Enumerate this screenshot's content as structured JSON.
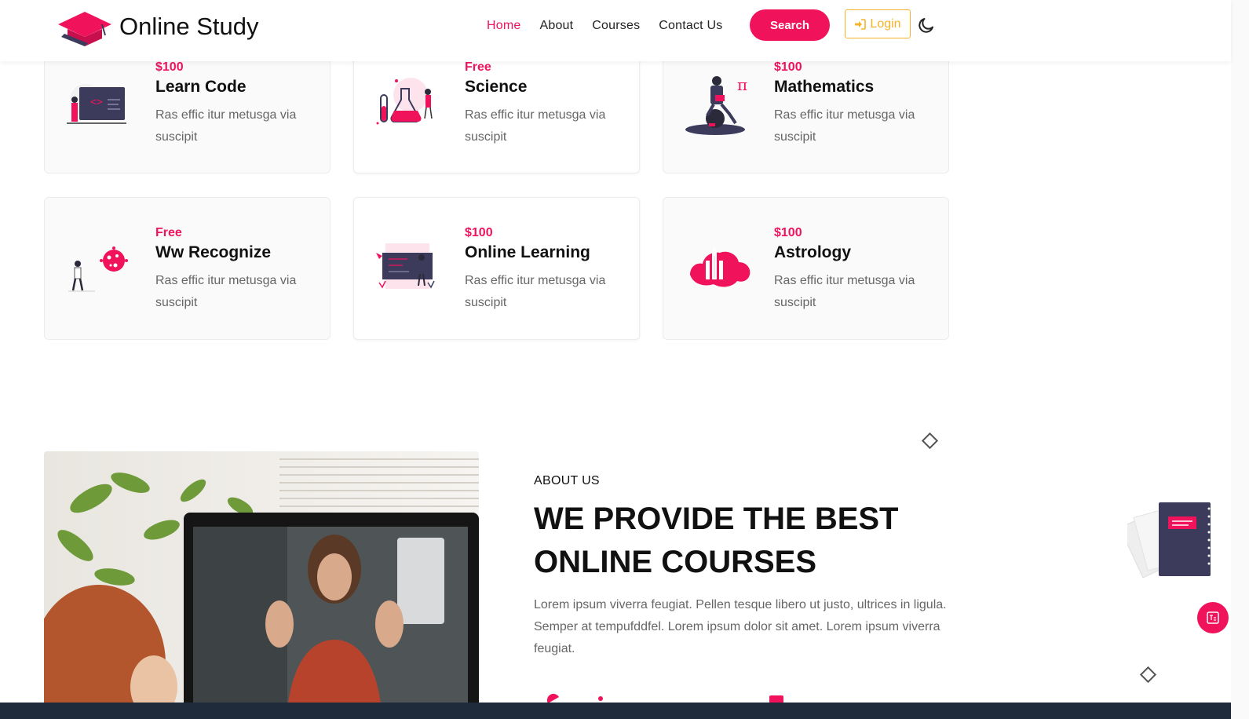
{
  "brand": {
    "name": "Online Study"
  },
  "nav": {
    "items": [
      {
        "label": "Home",
        "active": true
      },
      {
        "label": "About",
        "active": false
      },
      {
        "label": "Courses",
        "active": false
      },
      {
        "label": "Contact Us",
        "active": false
      }
    ],
    "search_label": "Search",
    "login_label": "Login"
  },
  "courses": [
    {
      "price": "$100",
      "title": "Learn Code",
      "desc": "Ras effic itur metusga via suscipit",
      "icon": "code-screen-illustration"
    },
    {
      "price": "Free",
      "title": "Science",
      "desc": "Ras effic itur metusga via suscipit",
      "icon": "science-flask-illustration"
    },
    {
      "price": "$100",
      "title": "Mathematics",
      "desc": "Ras effic itur metusga via suscipit",
      "icon": "math-reader-illustration"
    },
    {
      "price": "Free",
      "title": "Ww Recognize",
      "desc": "Ras effic itur metusga via suscipit",
      "icon": "virus-recognize-illustration"
    },
    {
      "price": "$100",
      "title": "Online Learning",
      "desc": "Ras effic itur metusga via suscipit",
      "icon": "online-board-illustration"
    },
    {
      "price": "$100",
      "title": "Astrology",
      "desc": "Ras effic itur metusga via suscipit",
      "icon": "rocket-cloud-illustration"
    }
  ],
  "about": {
    "label": "ABOUT US",
    "heading": "WE PROVIDE THE BEST ONLINE COURSES",
    "text": "Lorem ipsum viverra feugiat. Pellen tesque libero ut justo, ultrices in ligula. Semper at tempufddfel. Lorem ipsum dolor sit amet. Lorem ipsum viverra feugiat."
  },
  "colors": {
    "accent": "#f0135c",
    "login": "#f5b32a",
    "dark": "#3d3b5c"
  }
}
